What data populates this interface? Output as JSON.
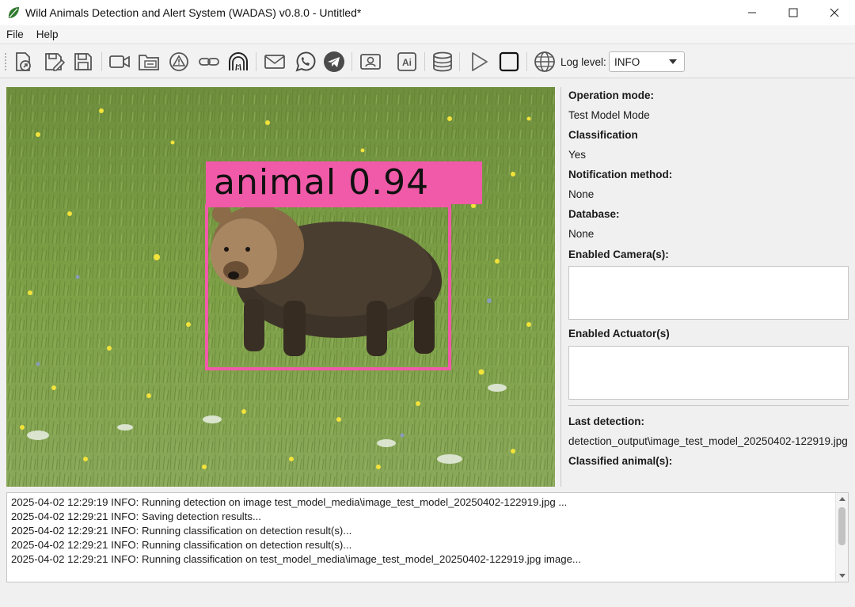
{
  "window": {
    "title": "Wild Animals Detection and Alert System (WADAS)  v0.8.0 - Untitled*",
    "controls": {
      "minimize": "—",
      "maximize": "☐",
      "close": "✕"
    }
  },
  "menu": {
    "items": [
      "File",
      "Help"
    ]
  },
  "toolbar": {
    "icons": [
      "select-mode-icon",
      "save-as-icon",
      "save-icon",
      "camera-icon",
      "ftp-folder-icon",
      "actuator-alert-icon",
      "connect-icon",
      "tunnel-icon",
      "email-icon",
      "whatsapp-icon",
      "telegram-icon",
      "ai-model-settings-icon",
      "ai-icon",
      "database-icon",
      "run-icon",
      "stop-icon",
      "globe-icon"
    ],
    "log_level_label": "Log level:",
    "log_level_value": "INFO"
  },
  "detection": {
    "label": "animal 0.94",
    "box_color": "#f05aa8"
  },
  "info": {
    "operation_mode_label": "Operation mode:",
    "operation_mode_value": "Test Model Mode",
    "classification_label": "Classification",
    "classification_value": "Yes",
    "notification_label": "Notification method:",
    "notification_value": "None",
    "database_label": "Database:",
    "database_value": "None",
    "cameras_label": "Enabled Camera(s):",
    "actuators_label": "Enabled Actuator(s)",
    "last_detection_label": "Last detection:",
    "last_detection_value": "detection_output\\image_test_model_20250402-122919.jpg",
    "classified_label": "Classified animal(s):"
  },
  "log": {
    "lines": [
      "2025-04-02 12:29:19 INFO: Running detection on image test_model_media\\image_test_model_20250402-122919.jpg ...",
      "2025-04-02 12:29:21 INFO: Saving detection results...",
      "2025-04-02 12:29:21 INFO: Running classification on detection result(s)...",
      "2025-04-02 12:29:21 INFO: Running classification on detection result(s)...",
      "2025-04-02 12:29:21 INFO: Running classification on test_model_media\\image_test_model_20250402-122919.jpg image..."
    ]
  }
}
